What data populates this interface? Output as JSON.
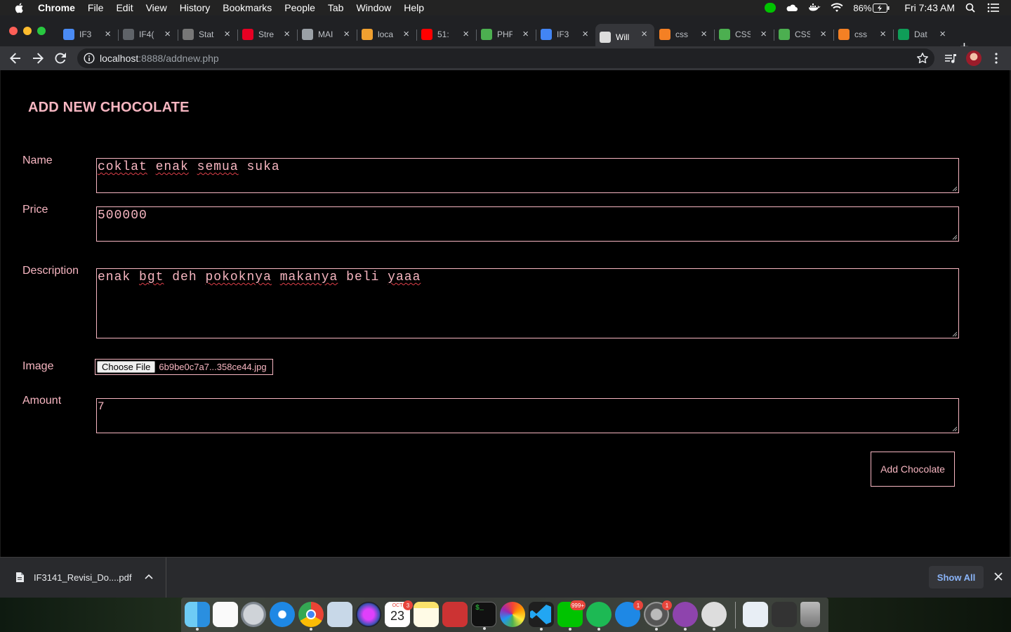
{
  "menubar": {
    "app": "Chrome",
    "items": [
      "File",
      "Edit",
      "View",
      "History",
      "Bookmarks",
      "People",
      "Tab",
      "Window",
      "Help"
    ],
    "battery": "86%",
    "clock": "Fri 7:43 AM"
  },
  "tabs": [
    {
      "label": "IF3",
      "icon": "chrome-icon",
      "color": "#4a8bf5"
    },
    {
      "label": "IF4(",
      "icon": "globe-icon",
      "color": "#5f6368"
    },
    {
      "label": "Stat",
      "icon": "stats-icon",
      "color": "#777777"
    },
    {
      "label": "Stre",
      "icon": "pinterest-icon",
      "color": "#e60023"
    },
    {
      "label": "MAI",
      "icon": "elephant-icon",
      "color": "#9aa0a6"
    },
    {
      "label": "loca",
      "icon": "xampp-icon",
      "color": "#f0a030"
    },
    {
      "label": "51:",
      "icon": "youtube-icon",
      "color": "#ff0000"
    },
    {
      "label": "PHF",
      "icon": "w3schools-icon",
      "color": "#4caf50"
    },
    {
      "label": "IF3",
      "icon": "docs-icon",
      "color": "#4285f4"
    },
    {
      "label": "Will",
      "icon": "elephant-icon",
      "color": "#dddddd",
      "active": true
    },
    {
      "label": "css",
      "icon": "stackoverflow-icon",
      "color": "#f48024"
    },
    {
      "label": "CSS",
      "icon": "w3schools-icon",
      "color": "#4caf50"
    },
    {
      "label": "CSS",
      "icon": "w3schools-icon",
      "color": "#4caf50"
    },
    {
      "label": "css",
      "icon": "stackoverflow-icon",
      "color": "#f48024"
    },
    {
      "label": "Dat",
      "icon": "sheets-icon",
      "color": "#0f9d58"
    }
  ],
  "address": {
    "host": "localhost",
    "path": ":8888/addnew.php"
  },
  "page": {
    "title": "ADD NEW CHOCOLATE",
    "labels": {
      "name": "Name",
      "price": "Price",
      "description": "Description",
      "image": "Image",
      "amount": "Amount"
    },
    "values": {
      "name_words": [
        "coklat",
        "enak",
        "semua",
        "suka"
      ],
      "price": "500000",
      "description_words": [
        "enak",
        "bgt",
        "deh",
        "pokoknya",
        "makanya",
        "beli",
        "yaaa"
      ],
      "amount": "7"
    },
    "file": {
      "button": "Choose File",
      "name": "6b9be0c7a7...358ce44.jpg"
    },
    "submit": "Add Chocolate",
    "accent_color": "#f7b6c1"
  },
  "downloads": {
    "file": "IF3141_Revisi_Do....pdf",
    "show_all": "Show All"
  },
  "dock": {
    "calendar_month": "OCT",
    "calendar_day": "23",
    "badges": {
      "calendar": "3",
      "line": "999+",
      "appstore": "1",
      "settings": "1"
    }
  }
}
